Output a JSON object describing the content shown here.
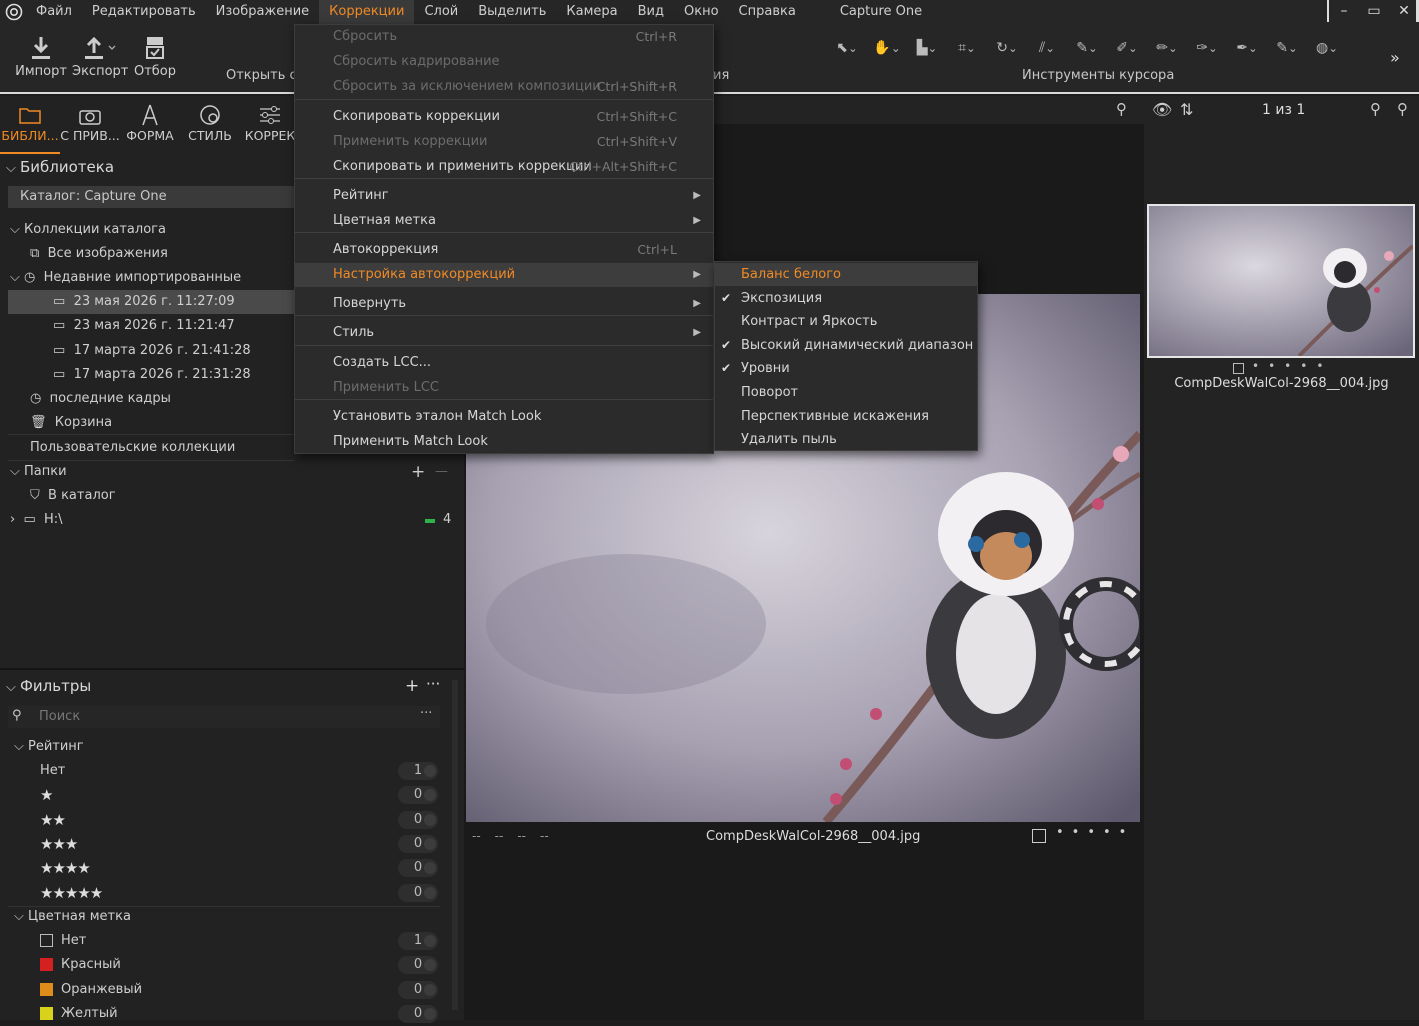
{
  "menubar": {
    "items": [
      "Файл",
      "Редактировать",
      "Изображение",
      "Коррекции",
      "Слой",
      "Выделить",
      "Камера",
      "Вид",
      "Окно",
      "Справка"
    ],
    "active_index": 3,
    "app_title": "Capture One"
  },
  "window_controls": {
    "minimize": "–",
    "maximize": "▭",
    "close": "✕"
  },
  "toolbar": {
    "import_label": "Импорт",
    "export_label": "Экспорт",
    "select_label": "Отбор",
    "open_label": "Открыть со",
    "hidden_label": "ия",
    "cursor_tools_label": "Инструменты курсора",
    "icons": [
      "arrow-select",
      "pan-hand",
      "stamp",
      "crop",
      "rotate",
      "straighten",
      "picker",
      "eraser-brush",
      "brush",
      "eraser",
      "pen",
      "gradient",
      "color-picker"
    ]
  },
  "tool_tabs": [
    {
      "label": "БИБЛИ...",
      "icon": "folder"
    },
    {
      "label": "С ПРИВ...",
      "icon": "camera"
    },
    {
      "label": "ФОРМА",
      "icon": "compass"
    },
    {
      "label": "СТИЛЬ",
      "icon": "style"
    },
    {
      "label": "КОРРЕК",
      "icon": "sliders"
    }
  ],
  "library": {
    "title": "Библиотека",
    "catalog": "Каталог: Capture One",
    "catalog_collections": "Коллекции каталога",
    "all_images": "Все изображения",
    "recent_imports": "Недавние импортированные",
    "imports": [
      "23 мая 2026 г. 11:27:09",
      "23 мая 2026 г. 11:21:47",
      "17 марта 2026 г. 21:41:28",
      "17 марта 2026 г. 21:31:28"
    ],
    "recent_captures": "последние кадры",
    "trash": "Корзина",
    "user_collections": "Пользовательские коллекции",
    "folders": "Папки",
    "to_catalog": "В каталог",
    "drive": "H:\\",
    "drive_count": "4"
  },
  "filters": {
    "title": "Фильтры",
    "search_placeholder": "Поиск",
    "rating_title": "Рейтинг",
    "rating_rows": [
      {
        "label": "Нет",
        "stars": 0,
        "count": "1"
      },
      {
        "label": "",
        "stars": 1,
        "count": "0"
      },
      {
        "label": "",
        "stars": 2,
        "count": "0"
      },
      {
        "label": "",
        "stars": 3,
        "count": "0"
      },
      {
        "label": "",
        "stars": 4,
        "count": "0"
      },
      {
        "label": "",
        "stars": 5,
        "count": "0"
      }
    ],
    "color_title": "Цветная метка",
    "color_rows": [
      {
        "label": "Нет",
        "color": "none",
        "count": "1"
      },
      {
        "label": "Красный",
        "color": "#d42020",
        "count": "0"
      },
      {
        "label": "Оранжевый",
        "color": "#e08c1a",
        "count": "0"
      },
      {
        "label": "Желтый",
        "color": "#d8d21c",
        "count": "0"
      }
    ]
  },
  "viewer": {
    "filename": "CompDeskWalCol-2968__004.jpg",
    "meta": [
      "--",
      "--",
      "--",
      "--"
    ],
    "counter": "1 из 1"
  },
  "browser": {
    "filename": "CompDeskWalCol-2968__004.jpg"
  },
  "menu": {
    "items": [
      {
        "label": "Сбросить",
        "shortcut": "Ctrl+R",
        "disabled": true
      },
      {
        "label": "Сбросить кадрирование",
        "shortcut": "",
        "disabled": true
      },
      {
        "label": "Сбросить за исключением композиции",
        "shortcut": "Ctrl+Shift+R",
        "disabled": true
      },
      {
        "label": "Скопировать коррекции",
        "shortcut": "Ctrl+Shift+C",
        "disabled": false
      },
      {
        "label": "Применить коррекции",
        "shortcut": "Ctrl+Shift+V",
        "disabled": true
      },
      {
        "label": "Скопировать и применить коррекции",
        "shortcut": "Ctrl+Alt+Shift+C",
        "disabled": false
      },
      {
        "label": "Рейтинг",
        "shortcut": "",
        "submenu": true
      },
      {
        "label": "Цветная метка",
        "shortcut": "",
        "submenu": true
      },
      {
        "label": "Автокоррекция",
        "shortcut": "Ctrl+L"
      },
      {
        "label": "Настройка автокоррекций",
        "shortcut": "",
        "submenu": true,
        "highlight": true
      },
      {
        "label": "Повернуть",
        "shortcut": "",
        "submenu": true
      },
      {
        "label": "Стиль",
        "shortcut": "",
        "submenu": true
      },
      {
        "label": "Создать LCC...",
        "shortcut": ""
      },
      {
        "label": "Применить LCC",
        "shortcut": "",
        "disabled": true
      },
      {
        "label": "Установить эталон Match Look",
        "shortcut": ""
      },
      {
        "label": "Применить Match Look",
        "shortcut": ""
      }
    ]
  },
  "submenu": {
    "items": [
      {
        "label": "Баланс белого",
        "checked": false,
        "highlight": true
      },
      {
        "label": "Экспозиция",
        "checked": true
      },
      {
        "label": "Контраст и Яркость",
        "checked": false
      },
      {
        "label": "Высокий динамический диапазон",
        "checked": true
      },
      {
        "label": "Уровни",
        "checked": true
      },
      {
        "label": "Поворот",
        "checked": false
      },
      {
        "label": "Перспективные искажения",
        "checked": false
      },
      {
        "label": "Удалить пыль",
        "checked": false
      }
    ]
  },
  "colors": {
    "accent": "#f08a24",
    "panel": "#222222",
    "menu": "#2b2b2b"
  }
}
